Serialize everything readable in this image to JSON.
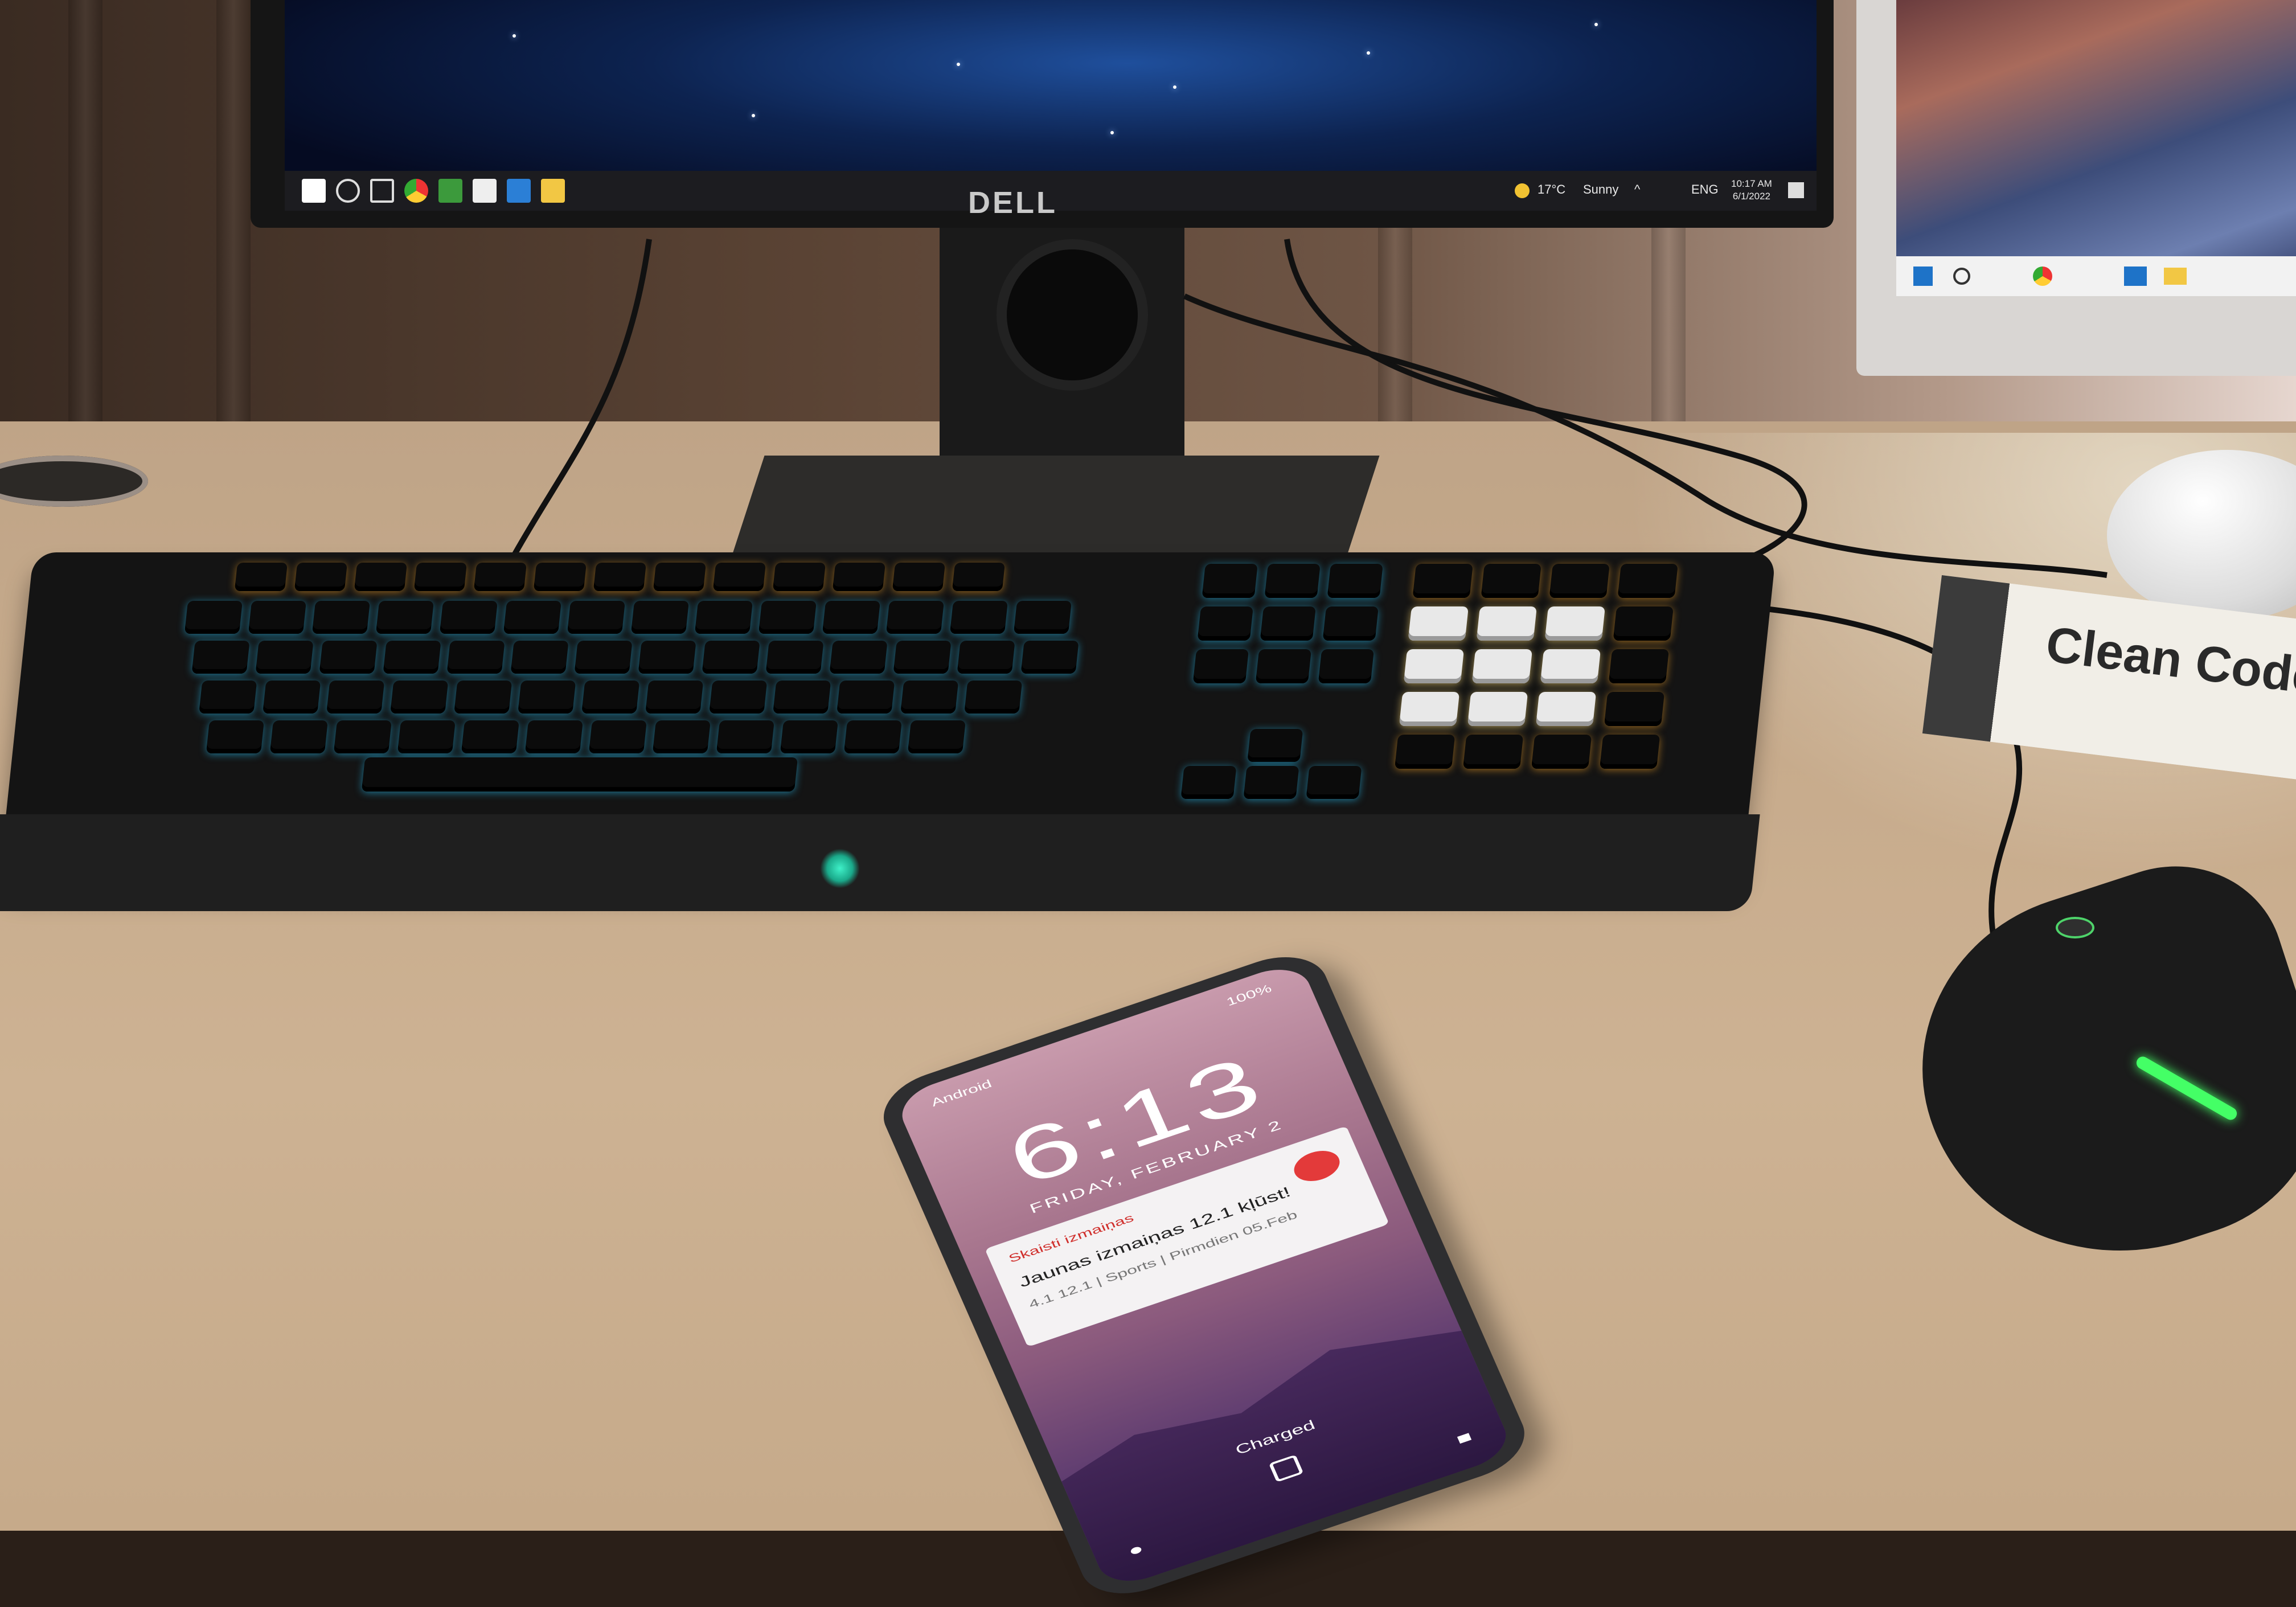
{
  "monitor": {
    "brand": "DELL",
    "taskbar": {
      "weather_temp": "17°C",
      "weather_text": "Sunny",
      "language": "ENG",
      "time": "10:17 AM",
      "date": "6/1/2022",
      "icons": [
        "windows-start-icon",
        "search-icon",
        "task-view-icon",
        "chrome-icon",
        "files-icon",
        "store-icon",
        "mail-icon",
        "folder-icon"
      ]
    }
  },
  "book": {
    "title": "Clean Code"
  },
  "keyboard": {
    "brand_logo": "razer-logo"
  },
  "phone": {
    "carrier": "Android",
    "battery": "100%",
    "time": "6:13",
    "date": "FRIDAY, FEBRUARY 2",
    "notification": {
      "app": "Skaisti izmaiņas",
      "title": "Jaunas izmaiņas 12.1 kļūst!",
      "subtitle": "4.1 12.1 | Sports | Pirmdien 05.Feb"
    },
    "status": "Charged"
  },
  "colors": {
    "keyboard_backlight": "#28c8ff",
    "numpad_backlight": "#ffaa28",
    "mouse_accent": "#44ff66"
  }
}
